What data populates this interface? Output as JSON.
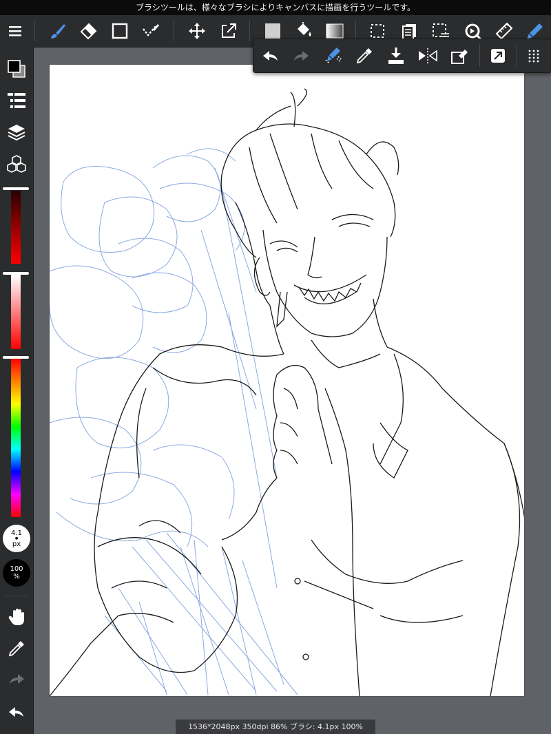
{
  "topbar": {
    "message": "ブラシツールは、様々なブラシによりキャンバスに描画を行うツールです。"
  },
  "toolbar": {
    "tools": [
      {
        "name": "menu-button",
        "icon": "hamburger-icon"
      },
      {
        "name": "brush-tool",
        "icon": "brush-icon",
        "active": true
      },
      {
        "name": "eraser-tool",
        "icon": "eraser-icon"
      },
      {
        "name": "shape-tool",
        "icon": "square-icon"
      },
      {
        "name": "select-pen-tool",
        "icon": "check-brush-icon"
      },
      {
        "name": "move-tool",
        "icon": "move-icon"
      },
      {
        "name": "transform-tool",
        "icon": "transform-icon"
      },
      {
        "name": "fill-color-tool",
        "icon": "fill-square-icon"
      },
      {
        "name": "bucket-tool",
        "icon": "bucket-icon"
      },
      {
        "name": "gradient-tool",
        "icon": "gradient-icon"
      },
      {
        "name": "select-tool",
        "icon": "select-icon"
      },
      {
        "name": "copy-layer-tool",
        "icon": "copy-icon"
      },
      {
        "name": "select-deselect-tool",
        "icon": "select-list-icon"
      },
      {
        "name": "rotate-tool",
        "icon": "rotate-icon"
      },
      {
        "name": "ruler-tool",
        "icon": "ruler-icon"
      },
      {
        "name": "pen-settings-tool",
        "icon": "pen-blue-icon"
      }
    ]
  },
  "popup": {
    "items": [
      "undo-icon",
      "redo-icon",
      "brush-eraser-icon",
      "eyedropper-icon",
      "download-icon",
      "flip-icon",
      "clear-icon",
      "export-icon",
      "grid-dots-icon"
    ]
  },
  "sidebar": {
    "brush_size": {
      "value": "4.1",
      "unit": "px"
    },
    "opacity": {
      "value": "100",
      "unit": "%"
    }
  },
  "status": {
    "text": "1536*2048px 350dpi 86% ブラシ: 4.1px 100%"
  },
  "colors": {
    "accent": "#4d93e6",
    "primary": "#000000",
    "sketch_blue": "#8aa9e0",
    "line": "#1a1a1a"
  }
}
